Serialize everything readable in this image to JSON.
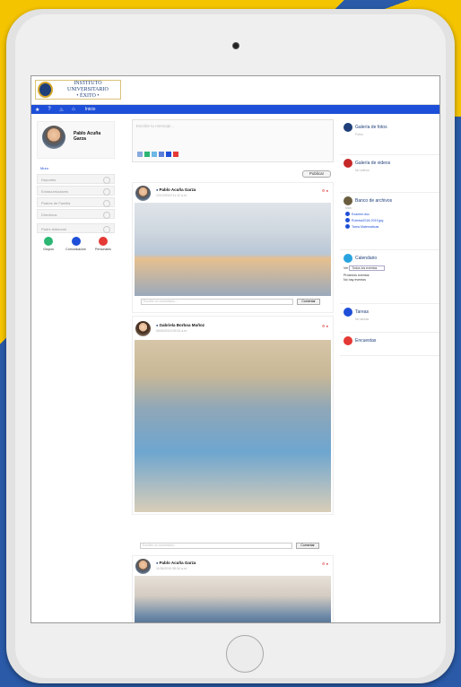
{
  "colors": {
    "brand_blue": "#1e4fd8",
    "brand_yellow": "#f4c400",
    "navy": "#1f3f7a"
  },
  "header": {
    "logo_line1": "INSTITUTO UNIVERSITARIO",
    "logo_line2": "• ÉXITO •"
  },
  "nav": {
    "icons": [
      "star-icon",
      "help-icon",
      "home-icon",
      "bell-icon"
    ],
    "label": "Inicio"
  },
  "profile": {
    "name": "Pablo Acuña Garza"
  },
  "left_menu": {
    "muro": "Muro",
    "items": [
      "Deportes",
      "Extracurriculares",
      "Padres de Familia",
      "Directivos"
    ],
    "extra_item": "Padre Adicional",
    "icons": [
      {
        "label": "Grupos",
        "color": "#2bb673"
      },
      {
        "label": "Comunicación",
        "color": "#1e4fd8"
      },
      {
        "label": "Personales",
        "color": "#e53935"
      }
    ]
  },
  "composer": {
    "placeholder": "Escribe tu mensaje..."
  },
  "publish_label": "Publicar",
  "posts": [
    {
      "author": "Pablo Acuña Garza",
      "date": "12/12/2019 11:12 a.m.",
      "comment_placeholder": "Escribe un comentario...",
      "comment_btn": "Comentar"
    },
    {
      "author": "Gabriela Borboa Muñoz",
      "date": "06/09/2019 09:03 a.m."
    },
    {
      "author": "Pablo Acuña Garza",
      "date": "11/06/2019 08:34 a.m.",
      "comment_placeholder_prev": "Escribe un comentario...",
      "comment_btn_prev": "Comentar"
    }
  ],
  "right_col": {
    "galeria_fotos": {
      "title": "Galería de fotos",
      "sub": "Fotos"
    },
    "galeria_videos": {
      "title": "Galería de videos",
      "sub": "No videos"
    },
    "banco": {
      "title": "Banco de archivos",
      "sub": "Mas:",
      "links": [
        "Examen.doc",
        "Rubrica2018-2019.jpg",
        "Tarea Matematicas"
      ]
    },
    "calendario": {
      "title": "Calendario",
      "filter_label": "Ver",
      "filter_value": "Todos los eventos",
      "next_label": "Próximos eventos",
      "none": "No hay eventos"
    },
    "tareas": {
      "title": "Tareas",
      "sub": "No tareas"
    },
    "encuestas": {
      "title": "Encuestas"
    }
  }
}
